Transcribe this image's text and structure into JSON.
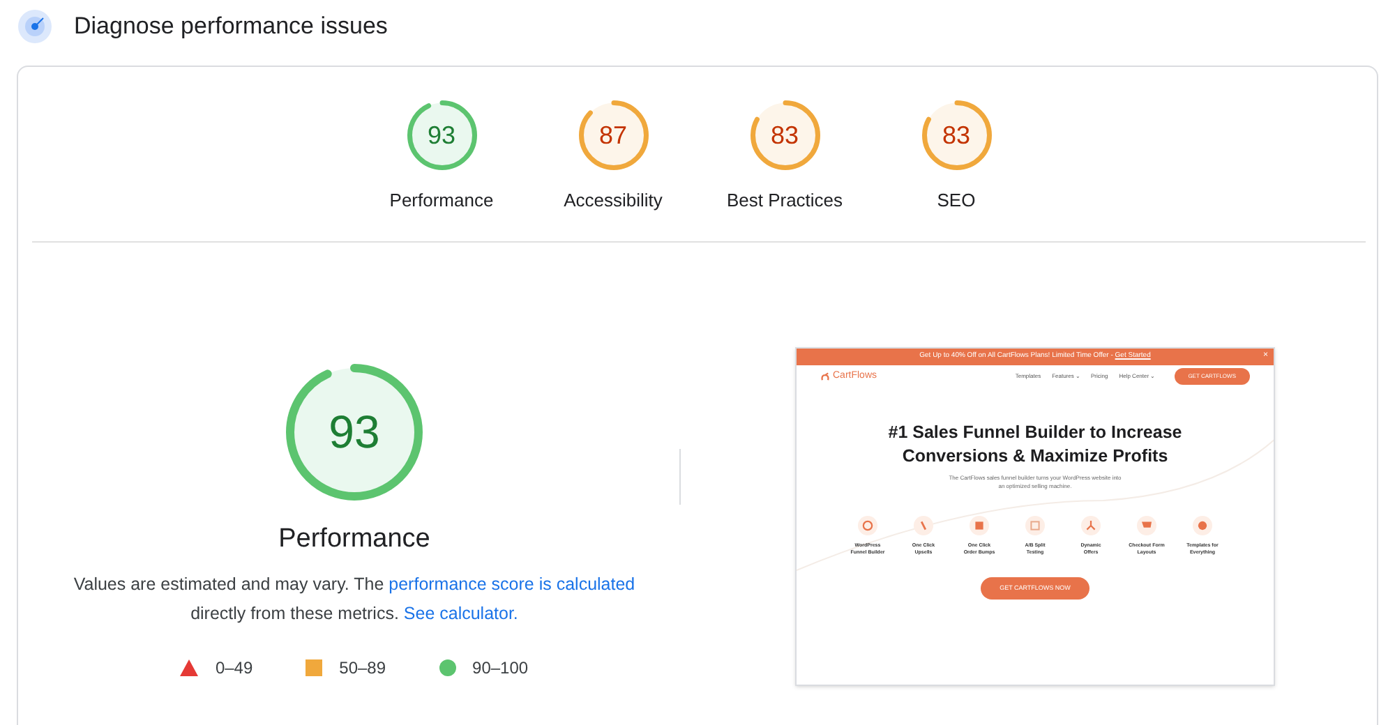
{
  "header": {
    "title": "Diagnose performance issues"
  },
  "gauges": [
    {
      "score": "93",
      "label": "Performance",
      "level": 0.93
    },
    {
      "score": "87",
      "label": "Accessibility",
      "level": 0.87
    },
    {
      "score": "83",
      "label": "Best Practices",
      "level": 0.83
    },
    {
      "score": "83",
      "label": "SEO",
      "level": 0.83
    }
  ],
  "main_gauge": {
    "score": "93",
    "label": "Performance",
    "level": 0.93
  },
  "description": {
    "before": "Values are estimated and may vary. The ",
    "link1": "performance score is calculated",
    "middle": "directly from these metrics.",
    "link2": "See calculator."
  },
  "legend": [
    {
      "kind": "fail",
      "range": "0–49"
    },
    {
      "kind": "average",
      "range": "50–89"
    },
    {
      "kind": "pass",
      "range": "90–100"
    }
  ],
  "page_screenshot": {
    "promo": "Get Up to 40% Off on All CartFlows Plans! Limited Time Offer - ",
    "promo_link": "Get Started",
    "close": "×",
    "logo": "CartFlows",
    "nav": [
      "Templates",
      "Features ⌄",
      "Pricing",
      "Help Center ⌄"
    ],
    "nav_button": "GET CARTFLOWS",
    "heading": [
      "#1 Sales Funnel Builder to Increase",
      "Conversions & Maximize Profits"
    ],
    "subtitle": [
      "The CartFlows sales funnel builder turns your WordPress website into",
      "an optimized selling machine."
    ],
    "features": [
      [
        "WordPress",
        "Funnel Builder"
      ],
      [
        "One Click",
        "Upsells"
      ],
      [
        "One Click",
        "Order Bumps"
      ],
      [
        "A/B Split",
        "Testing"
      ],
      [
        "Dynamic",
        "Offers"
      ],
      [
        "Checkout Form",
        "Layouts"
      ],
      [
        "Templates for",
        "Everything"
      ]
    ],
    "cta": "GET CARTFLOWS NOW"
  }
}
